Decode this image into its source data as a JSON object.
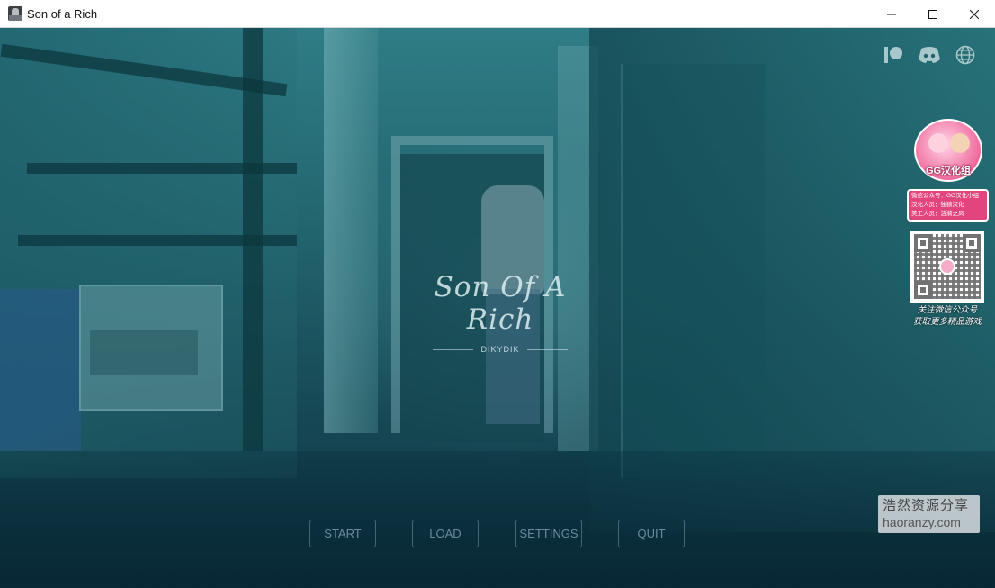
{
  "window": {
    "title": "Son of a Rich",
    "controls": {
      "minimize": "—",
      "maximize": "☐",
      "close": "✕"
    }
  },
  "top_icons": [
    "patreon-icon",
    "discord-icon",
    "globe-icon"
  ],
  "logo": {
    "title": "Son Of A Rich",
    "subtitle": "DIKYDIK"
  },
  "menu": {
    "start": "START",
    "load": "LOAD",
    "settings": "SETTINGS",
    "quit": "QUIT"
  },
  "badge": {
    "logo_text": "GG汉化组",
    "info_lines": [
      "微信公众号：GG汉化小组",
      "汉化人员：独狼汉化",
      "美工人员：涟漪之风"
    ],
    "qr_caption_lines": [
      "关注微信公众号",
      "获取更多精品游戏"
    ]
  },
  "watermark": {
    "line1": "浩然资源分享",
    "line2": "haoranzy.com"
  },
  "colors": {
    "scene_top": "#2f7d86",
    "scene_bottom": "#0d3340",
    "badge_pink": "#e2457e"
  }
}
